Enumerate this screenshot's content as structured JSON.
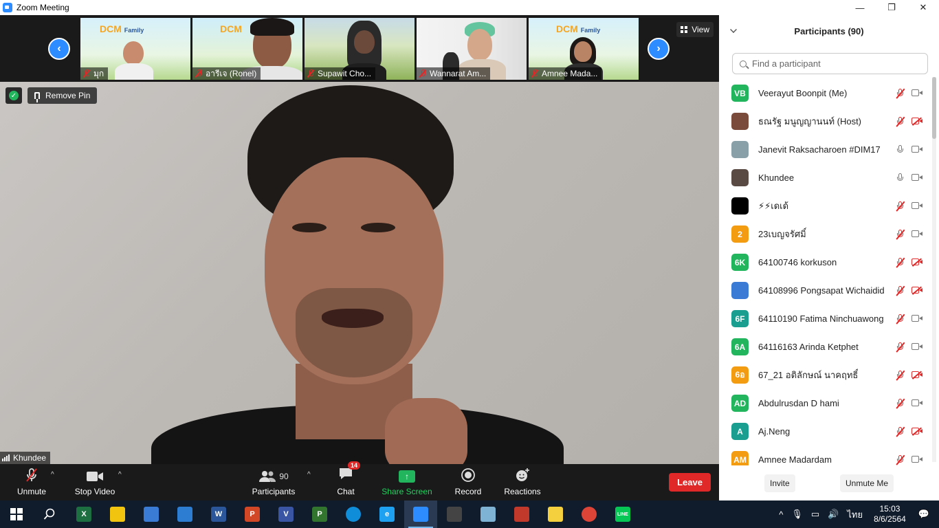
{
  "window": {
    "title": "Zoom Meeting",
    "controls": [
      "—",
      "❐",
      "✕"
    ]
  },
  "strip": {
    "prev_arrow": "‹",
    "next_arrow": "›",
    "view_label": "View",
    "thumbnails": [
      {
        "name": "มุก",
        "banner": "DCM",
        "banner_sub": "Family"
      },
      {
        "name": "อารีเจ (Ronel)",
        "banner": "DCM",
        "banner_sub": ""
      },
      {
        "name": "Supawit Cho...",
        "banner": "",
        "banner_sub": ""
      },
      {
        "name": "Wannarat Am...",
        "banner": "",
        "banner_sub": ""
      },
      {
        "name": "Amnee Mada...",
        "banner": "DCM",
        "banner_sub": "Family"
      }
    ]
  },
  "main": {
    "remove_pin": "Remove Pin",
    "speaker_name": "Khundee"
  },
  "toolbar": {
    "unmute": "Unmute",
    "stop_video": "Stop Video",
    "participants": "Participants",
    "participants_count": "90",
    "chat": "Chat",
    "chat_badge": "14",
    "share_screen": "Share Screen",
    "record": "Record",
    "reactions": "Reactions",
    "leave": "Leave"
  },
  "panel": {
    "title": "Participants (90)",
    "search_placeholder": "Find a participant",
    "invite": "Invite",
    "unmute_me": "Unmute Me",
    "participants": [
      {
        "initials": "VB",
        "color": "#23b45e",
        "name": "Veerayut Boonpit (Me)",
        "mic": "muted",
        "cam": "on"
      },
      {
        "initials": "",
        "color": "#7a4a3a",
        "name": "ธณรัฐ มนูญญานนท์ (Host)",
        "mic": "muted",
        "cam": "off"
      },
      {
        "initials": "",
        "color": "#8aa0a8",
        "name": "Janevit Raksacharoen #DIM17",
        "mic": "on",
        "cam": "on"
      },
      {
        "initials": "",
        "color": "#5a4a44",
        "name": "Khundee",
        "mic": "on",
        "cam": "on"
      },
      {
        "initials": "",
        "color": "#000000",
        "name": "⚡⚡เดเด้",
        "mic": "muted",
        "cam": "on"
      },
      {
        "initials": "2",
        "color": "#f39c12",
        "name": "23เบญจรัศมิ์",
        "mic": "muted",
        "cam": "on"
      },
      {
        "initials": "6K",
        "color": "#23b45e",
        "name": "64100746 korkuson",
        "mic": "muted",
        "cam": "off"
      },
      {
        "initials": "",
        "color": "#3a7bd5",
        "name": "64108996  Pongsapat Wichaidid",
        "mic": "muted",
        "cam": "off"
      },
      {
        "initials": "6F",
        "color": "#1a9e8f",
        "name": "64110190 Fatima Ninchuawong",
        "mic": "muted",
        "cam": "on"
      },
      {
        "initials": "6A",
        "color": "#23b45e",
        "name": "64116163 Arinda Ketphet",
        "mic": "muted",
        "cam": "on"
      },
      {
        "initials": "6อ",
        "color": "#f39c12",
        "name": "67_21 อติลักษณ์ นาคฤทธิ์",
        "mic": "muted",
        "cam": "off"
      },
      {
        "initials": "AD",
        "color": "#23b45e",
        "name": "Abdulrusdan D hami",
        "mic": "muted",
        "cam": "on"
      },
      {
        "initials": "A",
        "color": "#1a9e8f",
        "name": "Aj.Neng",
        "mic": "muted",
        "cam": "off"
      },
      {
        "initials": "AM",
        "color": "#f39c12",
        "name": "Amnee Madardam",
        "mic": "muted",
        "cam": "on"
      }
    ]
  },
  "taskbar": {
    "apps": [
      {
        "icon": "excel-icon",
        "label": "X",
        "color": "#1d6f42"
      },
      {
        "icon": "file-explorer-icon",
        "label": "",
        "color": "#f1c40f"
      },
      {
        "icon": "store-icon",
        "label": "",
        "color": "#3a7bd5"
      },
      {
        "icon": "mail-icon",
        "label": "",
        "color": "#2d7dd2"
      },
      {
        "icon": "word-icon",
        "label": "W",
        "color": "#2b579a"
      },
      {
        "icon": "powerpoint-icon",
        "label": "P",
        "color": "#d24726"
      },
      {
        "icon": "visio-icon",
        "label": "V",
        "color": "#3955a3"
      },
      {
        "icon": "project-icon",
        "label": "P",
        "color": "#31752f"
      },
      {
        "icon": "edge-icon",
        "label": "",
        "color": "#0f8dd8"
      },
      {
        "icon": "ie-icon",
        "label": "e",
        "color": "#1ea1f1"
      },
      {
        "icon": "zoom-icon",
        "label": "",
        "color": "#2d8cff"
      },
      {
        "icon": "camera-app-icon",
        "label": "",
        "color": "#444444"
      },
      {
        "icon": "notes-app-icon",
        "label": "",
        "color": "#7fb3d5"
      },
      {
        "icon": "paint-icon",
        "label": "",
        "color": "#c0392b"
      },
      {
        "icon": "sticky-notes-icon",
        "label": "",
        "color": "#f4d03f"
      },
      {
        "icon": "chrome-icon",
        "label": "",
        "color": "#db4437"
      },
      {
        "icon": "line-icon",
        "label": "LINE",
        "color": "#06c755"
      }
    ],
    "language": "ไทย",
    "time": "15:03",
    "date": "8/6/2564"
  }
}
